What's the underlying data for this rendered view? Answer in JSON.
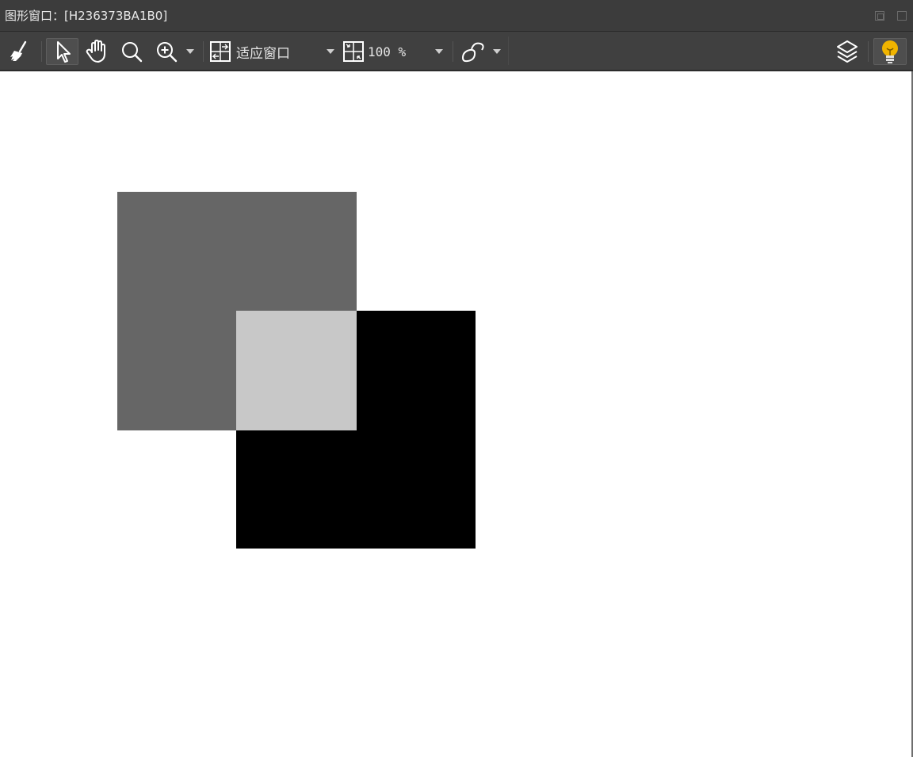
{
  "window": {
    "title": "图形窗口：[H236373BA1B0]",
    "controls": [
      "restore-icon",
      "maximize-icon"
    ]
  },
  "toolbar": {
    "tools": [
      "clear-broom-icon",
      "select-pointer-icon",
      "pan-hand-icon",
      "magnify-icon",
      "zoom-in-icon"
    ],
    "active_tool": "select-pointer-icon",
    "fit_mode_label": "适应窗口",
    "zoom_value": "100 %",
    "right_tools": [
      "layers-icon",
      "lightbulb-icon"
    ],
    "colors": {
      "toolbar_bg": "#404040",
      "titlebar_bg": "#3c3c3c",
      "icon": "#ffffff",
      "bulb": "#f0b400"
    }
  },
  "canvas": {
    "background": "#ffffff",
    "shapes": [
      {
        "name": "dark-gray-square",
        "fill": "#666666"
      },
      {
        "name": "black-square",
        "fill": "#000000"
      },
      {
        "name": "overlap-light-gray-square",
        "fill": "#c8c8c8"
      }
    ]
  }
}
